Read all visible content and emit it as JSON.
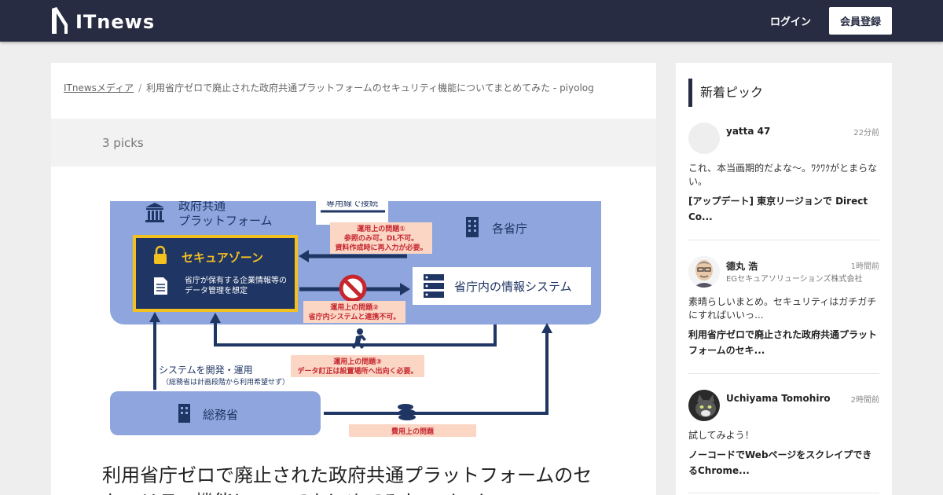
{
  "header": {
    "logo_text": "ITnews",
    "login_label": "ログイン",
    "signup_label": "会員登録"
  },
  "breadcrumb": {
    "home": "ITnewsメディア",
    "separator": "/",
    "current": "利用省庁ゼロで廃止された政府共通プラットフォームのセキュリティ機能についてまとめてみた - piyolog"
  },
  "picks_count": "3 picks",
  "article": {
    "title": "利用省庁ゼロで廃止された政府共通プラットフォームのセキュリティ機能についてまとめてみた - piyolog",
    "diagram": {
      "top_cut_label": "専用線で接続",
      "platform_label_1": "政府共通",
      "platform_label_2": "プラットフォーム",
      "ministries_label": "各省庁",
      "secure_zone_label": "セキュアゾーン",
      "secure_zone_desc_1": "省庁が保有する企業情報等の",
      "secure_zone_desc_2": "データ管理を想定",
      "ministry_system_label": "省庁内の情報システム",
      "issue1_title": "運用上の問題①",
      "issue1_line1": "参照のみ可。DL不可。",
      "issue1_line2": "資料作成時に再入力が必要。",
      "issue2_title": "運用上の問題②",
      "issue2_line1": "省庁内システムと連携不可。",
      "issue3_title": "運用上の問題③",
      "issue3_line1": "データ訂正は設置場所へ出向く必要。",
      "dev_label": "システムを開発・運用",
      "dev_note": "（総務省は計画段階から利用希望せず）",
      "mic_label": "総務省",
      "cost_issue_title": "費用上の問題"
    }
  },
  "sidebar": {
    "heading": "新着ピック",
    "picks": [
      {
        "user": "yatta 47",
        "org": "",
        "time": "22分前",
        "comment": "これ、本当画期的だよな～。ﾜｸﾜｸがとまらない。",
        "link": "[アップデート] 東京リージョンで Direct Co..."
      },
      {
        "user": "德丸 浩",
        "org": "EGセキュアソリューションズ株式会社",
        "time": "1時間前",
        "comment": "素晴らしいまとめ。セキュリティはガチガチにすればいいっ...",
        "link": "利用省庁ゼロで廃止された政府共通プラットフォームのセキ..."
      },
      {
        "user": "Uchiyama Tomohiro",
        "org": "",
        "time": "2時間前",
        "comment": "試してみよう！",
        "link": "ノーコードでWebページをスクレイプできるChrome..."
      }
    ]
  },
  "colors": {
    "header_bg": "#282c42",
    "diagram_blue": "#8ea6dd",
    "diagram_navy": "#1f3564",
    "secure_border": "#f3c11f",
    "issue_bg": "#fbd6c5",
    "issue_text": "#c6262e"
  }
}
